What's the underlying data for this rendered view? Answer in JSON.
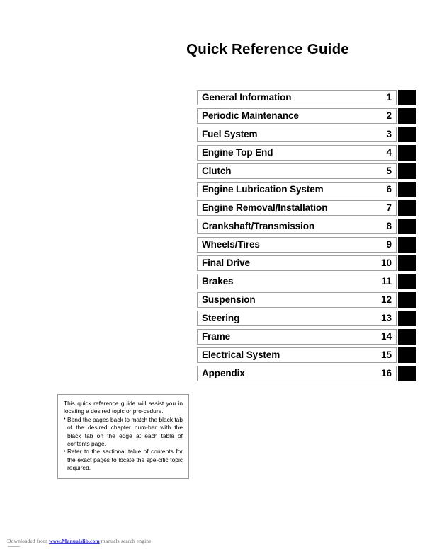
{
  "document": {
    "title": "Quick Reference Guide"
  },
  "index": {
    "rows": [
      {
        "label": "General Information",
        "number": "1"
      },
      {
        "label": "Periodic Maintenance",
        "number": "2"
      },
      {
        "label": "Fuel System",
        "number": "3"
      },
      {
        "label": "Engine Top End",
        "number": "4"
      },
      {
        "label": "Clutch",
        "number": "5"
      },
      {
        "label": "Engine Lubrication System",
        "number": "6"
      },
      {
        "label": "Engine Removal/Installation",
        "number": "7"
      },
      {
        "label": "Crankshaft/Transmission",
        "number": "8"
      },
      {
        "label": "Wheels/Tires",
        "number": "9"
      },
      {
        "label": "Final Drive",
        "number": "10"
      },
      {
        "label": "Brakes",
        "number": "11"
      },
      {
        "label": "Suspension",
        "number": "12"
      },
      {
        "label": "Steering",
        "number": "13"
      },
      {
        "label": "Frame",
        "number": "14"
      },
      {
        "label": "Electrical System",
        "number": "15"
      },
      {
        "label": "Appendix",
        "number": "16"
      }
    ],
    "tab_color": "#000000",
    "border_color": "#a0a0a0"
  },
  "note": {
    "intro": "This quick reference guide will assist you in locating a desired topic or pro-cedure.",
    "bullets": [
      "Bend the pages back to match the black tab of the desired chapter num-ber with the black tab on the edge at each table of contents page.",
      "Refer to the sectional table of contents for the exact pages to locate the spe-cific topic required."
    ]
  },
  "footer": {
    "prefix": "Downloaded from ",
    "link": "www.Manualslib.com",
    "suffix": " manuals search engine",
    "link_color": "#3b3bd6"
  }
}
